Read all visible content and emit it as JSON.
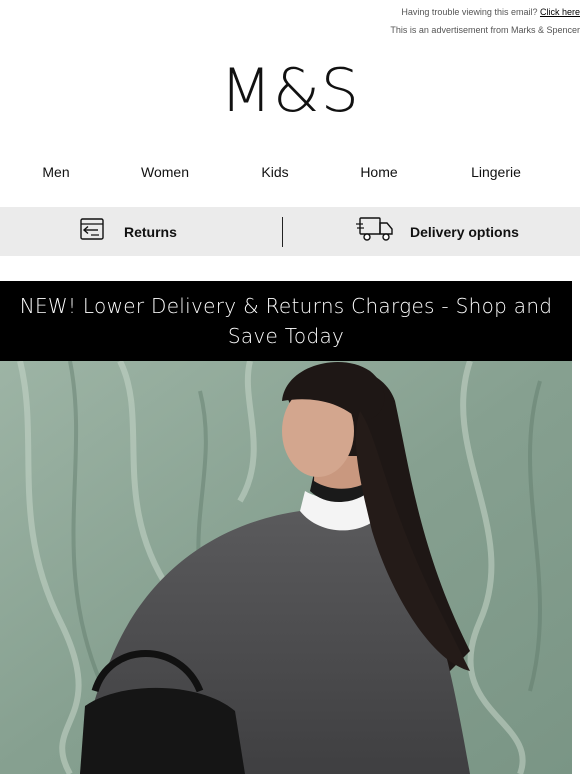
{
  "preheader": {
    "trouble_text": "Having trouble viewing this email?",
    "click_here": "Click here",
    "ad_text": "This is an advertisement from Marks & Spencer"
  },
  "brand": {
    "logo": "M&S"
  },
  "nav": {
    "items": [
      "Men",
      "Women",
      "Kids",
      "Home",
      "Lingerie"
    ]
  },
  "services": {
    "returns_label": "Returns",
    "delivery_label": "Delivery options"
  },
  "banner": {
    "text": "NEW! Lower Delivery & Returns Charges - Shop and Save Today"
  },
  "colors": {
    "banner_bg": "#000000",
    "service_bar_bg": "#ebebeb",
    "hero_backdrop": "#8fa898"
  },
  "icons": {
    "returns": "return-box-icon",
    "delivery": "delivery-truck-icon"
  }
}
